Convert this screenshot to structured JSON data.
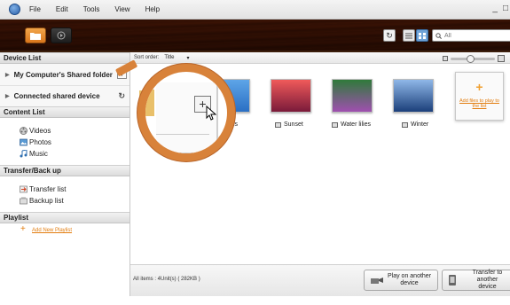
{
  "menu": {
    "items": [
      "File",
      "Edit",
      "Tools",
      "View",
      "Help"
    ],
    "window_controls": [
      "_",
      "□"
    ]
  },
  "search": {
    "placeholder": "All"
  },
  "sidebar": {
    "device_list": {
      "header": "Device List",
      "shared_folder": "My Computer's Shared folder",
      "connected_device": "Connected shared device"
    },
    "content_list": {
      "header": "Content List",
      "items": [
        "Videos",
        "Photos",
        "Music"
      ]
    },
    "transfer": {
      "header": "Transfer/Back up",
      "items": [
        "Transfer list",
        "Backup list"
      ]
    },
    "playlist": {
      "header": "Playlist",
      "add_label": "Add New Playlist"
    }
  },
  "main": {
    "sort_label": "Sort order:",
    "sort_value": "Title",
    "zoom_level": 0.35,
    "thumbnails": [
      {
        "label": "hills",
        "colors": [
          "#5ea5e8",
          "#2a6fc4"
        ]
      },
      {
        "label": "Sunset",
        "colors": [
          "#f05a5a",
          "#7a1a3a"
        ]
      },
      {
        "label": "Water lilies",
        "colors": [
          "#2f7a3a",
          "#a04fb0"
        ]
      },
      {
        "label": "Winter",
        "colors": [
          "#8fb7e8",
          "#1b3f7a"
        ]
      }
    ],
    "add_files_label": "Add files to play to the list"
  },
  "status": {
    "summary": "All items : 4Unit(s) ( 282KB )",
    "play_button": [
      "Play on another",
      "device"
    ],
    "transfer_button": [
      "Transfer to another",
      "device"
    ]
  },
  "colors": {
    "accent_orange": "#e27d0f",
    "magnifier_ring": "#d8823a"
  }
}
